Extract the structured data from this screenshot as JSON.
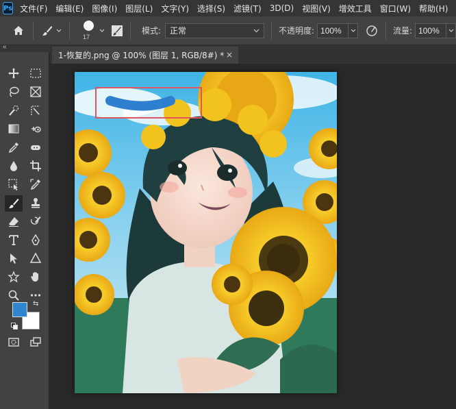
{
  "app": {
    "logo_text": "Ps"
  },
  "menu": [
    "文件(F)",
    "编辑(E)",
    "图像(I)",
    "图层(L)",
    "文字(Y)",
    "选择(S)",
    "滤镜(T)",
    "3D(D)",
    "视图(V)",
    "增效工具",
    "窗口(W)",
    "帮助(H)"
  ],
  "options": {
    "brush_size": "17",
    "mode_label": "模式:",
    "mode_value": "正常",
    "opacity_label": "不透明度:",
    "opacity_value": "100%",
    "flow_label": "流量:",
    "flow_value": "100%"
  },
  "panel": {
    "collapse_label": "«"
  },
  "document": {
    "tab_title": "1-恢复的.png @ 100% (图层 1, RGB/8#) *",
    "close_glyph": "×"
  },
  "colors": {
    "foreground": "#2e86d1",
    "background": "#ffffff",
    "selection": "#e0555f",
    "brush_stroke": "#2f7fd0"
  },
  "tools": [
    "move-icon",
    "marquee-icon",
    "lasso-icon",
    "frame-icon",
    "quick-select-icon",
    "slice-icon",
    "gradient-icon",
    "content-aware-move-icon",
    "eyedropper-icon",
    "spot-healing-icon",
    "blur-icon",
    "crop-icon",
    "object-select-icon",
    "color-sampler-icon",
    "brush-icon",
    "stamp-icon",
    "eraser-icon",
    "history-brush-icon",
    "text-icon",
    "pen-icon",
    "path-select-icon",
    "shape-icon",
    "custom-shape-icon",
    "hand-icon",
    "zoom-icon",
    "more-icon",
    "quick-mask-icon",
    "screen-mode-icon"
  ]
}
